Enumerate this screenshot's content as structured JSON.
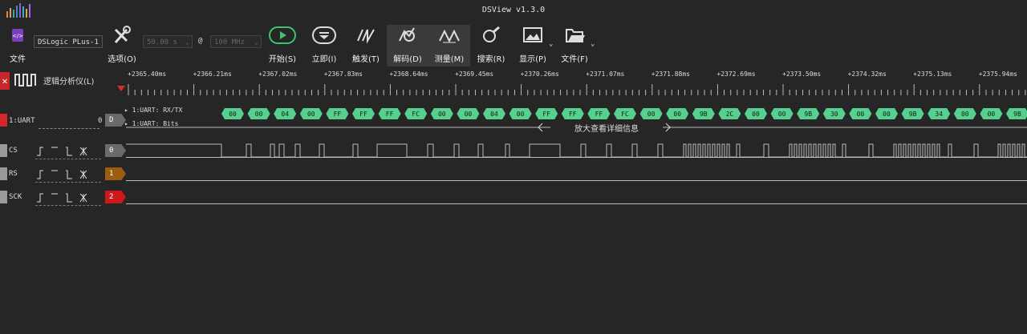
{
  "window": {
    "title": "DSView v1.3.0"
  },
  "toolbar": {
    "device": "DSLogic PLus-1",
    "file_label": "文件",
    "options_label": "选项(O)",
    "sample_depth": "50.00 s",
    "at_symbol": "@",
    "sample_rate": "100 MHz",
    "start_label": "开始(S)",
    "instant_label": "立即(I)",
    "trigger_label": "触发(T)",
    "decode_label": "解码(D)",
    "measure_label": "测量(M)",
    "search_label": "搜索(R)",
    "display_label": "显示(P)",
    "file2_label": "文件(F)"
  },
  "ruler": {
    "ticks": [
      "+2365.40ms",
      "+2366.21ms",
      "+2367.02ms",
      "+2367.83ms",
      "+2368.64ms",
      "+2369.45ms",
      "+2370.26ms",
      "+2371.07ms",
      "+2371.88ms",
      "+2372.69ms",
      "+2373.50ms",
      "+2374.32ms",
      "+2375.13ms",
      "+2375.94ms"
    ]
  },
  "logic_panel": {
    "label": "逻辑分析仪(L)"
  },
  "decoder": {
    "name": "1:UART",
    "index": "0",
    "badge": "D",
    "row1_label": "1:UART: RX/TX",
    "row2_label": "1:UART: Bits",
    "bytes": [
      "00",
      "00",
      "04",
      "00",
      "FF",
      "FF",
      "FF",
      "FC",
      "00",
      "00",
      "04",
      "00",
      "FF",
      "FF",
      "FF",
      "FC",
      "00",
      "00",
      "9B",
      "2C",
      "00",
      "00",
      "9B",
      "30",
      "00",
      "00",
      "9B",
      "34",
      "00",
      "00",
      "9B"
    ],
    "zoom_hint": "放大查看详细信息",
    "color": "#55d08e"
  },
  "channels": [
    {
      "name": "CS",
      "index": "0",
      "color": "#6a6a6a"
    },
    {
      "name": "RS",
      "index": "1",
      "color": "#9a5e0e"
    },
    {
      "name": "SCK",
      "index": "2",
      "color": "#cc1a1a"
    }
  ]
}
